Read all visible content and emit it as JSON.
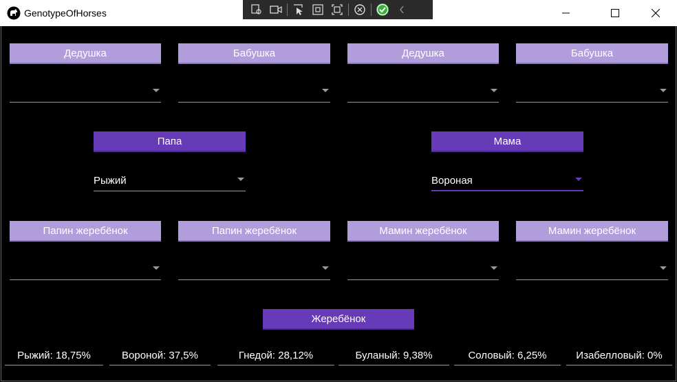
{
  "window": {
    "title": "GenotypeOfHorses"
  },
  "grandparents": [
    {
      "label": "Дедушка",
      "value": ""
    },
    {
      "label": "Бабушка",
      "value": ""
    },
    {
      "label": "Дедушка",
      "value": ""
    },
    {
      "label": "Бабушка",
      "value": ""
    }
  ],
  "parents": {
    "father": {
      "label": "Папа",
      "value": "Рыжий"
    },
    "mother": {
      "label": "Мама",
      "value": "Вороная"
    }
  },
  "siblings": [
    {
      "label": "Папин жеребёнок",
      "value": ""
    },
    {
      "label": "Папин жеребёнок",
      "value": ""
    },
    {
      "label": "Мамин жеребёнок",
      "value": ""
    },
    {
      "label": "Мамин жеребёнок",
      "value": ""
    }
  ],
  "foal": {
    "label": "Жеребёнок"
  },
  "results": [
    "Рыжий: 18,75%",
    "Вороной: 37,5%",
    "Гнедой: 28,12%",
    "Буланый: 9,38%",
    "Соловый: 6,25%",
    "Изабелловый: 0%"
  ],
  "colors": {
    "accent": "#673ab7",
    "light_accent": "#b19ddb",
    "background": "#000000"
  }
}
